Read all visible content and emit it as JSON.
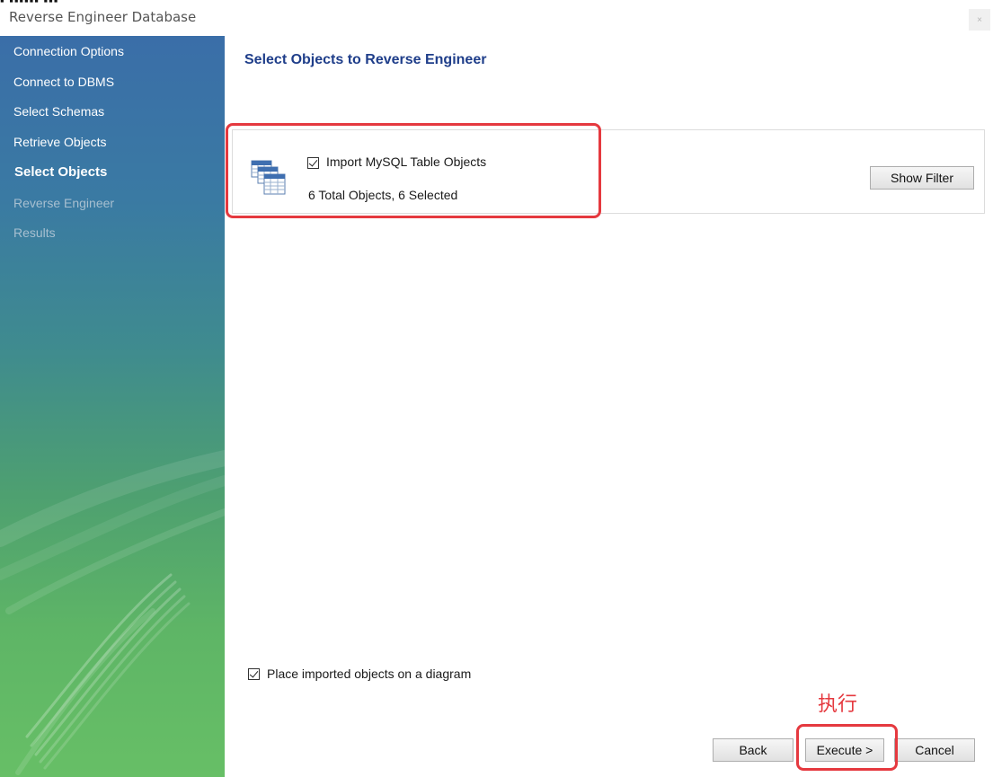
{
  "window": {
    "title": "Reverse Engineer Database",
    "close_glyph": "×"
  },
  "sidebar": {
    "steps": [
      {
        "label": "Connection Options",
        "state": "done"
      },
      {
        "label": "Connect to DBMS",
        "state": "done"
      },
      {
        "label": "Select Schemas",
        "state": "done"
      },
      {
        "label": "Retrieve Objects",
        "state": "done"
      },
      {
        "label": "Select Objects",
        "state": "active"
      },
      {
        "label": "Reverse Engineer",
        "state": "pending"
      },
      {
        "label": "Results",
        "state": "pending"
      }
    ]
  },
  "main": {
    "title": "Select Objects to Reverse Engineer",
    "import": {
      "checkbox_label": "Import MySQL Table Objects",
      "checked": true,
      "summary": "6 Total Objects, 6 Selected",
      "show_filter_label": "Show Filter",
      "icon": "table-objects-icon"
    },
    "place_on_diagram": {
      "label": "Place imported objects on a diagram",
      "checked": true
    },
    "buttons": {
      "back": "Back",
      "execute": "Execute >",
      "cancel": "Cancel"
    }
  },
  "annotations": {
    "execute_caption": "执行",
    "color": "#e5393f"
  },
  "colors": {
    "title_blue": "#1f3e8a",
    "sidebar_top": "#3a6ea8",
    "sidebar_bottom": "#67bf66"
  }
}
